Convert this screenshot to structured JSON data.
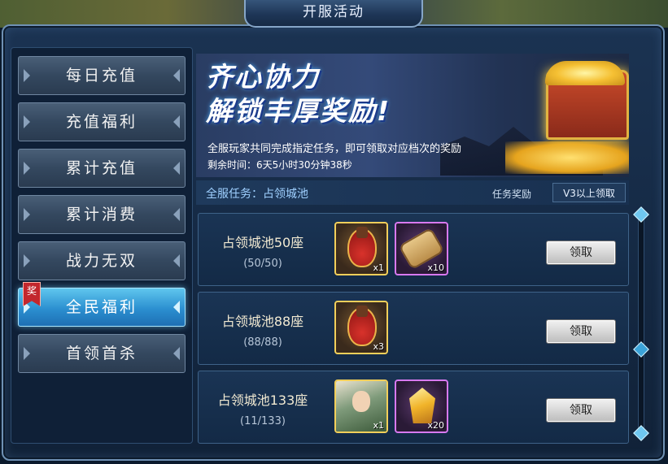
{
  "title": "开服活动",
  "sidebar": {
    "items": [
      {
        "label": "每日充值"
      },
      {
        "label": "充值福利"
      },
      {
        "label": "累计充值"
      },
      {
        "label": "累计消费"
      },
      {
        "label": "战力无双"
      },
      {
        "label": "全民福利",
        "active": true
      },
      {
        "label": "首领首杀"
      }
    ],
    "tag": "奖"
  },
  "banner": {
    "title_line1": "齐心协力",
    "title_line2": "解锁丰厚奖励!",
    "description": "全服玩家共同完成指定任务，即可领取对应档次的奖励",
    "time_left": "剩余时间：6天5小时30分钟38秒"
  },
  "task_header": {
    "title": "全服任务：占领城池",
    "reward_label": "任务奖励",
    "vip_label": "V3以上领取"
  },
  "tasks": [
    {
      "name": "占领城池50座",
      "progress": "(50/50)",
      "rewards": [
        {
          "icon": "gourd-icon",
          "qty": "x1",
          "quality": "gold"
        },
        {
          "icon": "scroll-icon",
          "qty": "x10",
          "quality": "purple"
        }
      ],
      "button": "领取"
    },
    {
      "name": "占领城池88座",
      "progress": "(88/88)",
      "rewards": [
        {
          "icon": "gourd-icon",
          "qty": "x3",
          "quality": "gold"
        }
      ],
      "button": "领取"
    },
    {
      "name": "占领城池133座",
      "progress": "(11/133)",
      "rewards": [
        {
          "icon": "hero-portrait-icon",
          "qty": "x1",
          "quality": "gold"
        },
        {
          "icon": "crystal-icon",
          "qty": "x20",
          "quality": "purple"
        }
      ],
      "button": "领取"
    }
  ]
}
